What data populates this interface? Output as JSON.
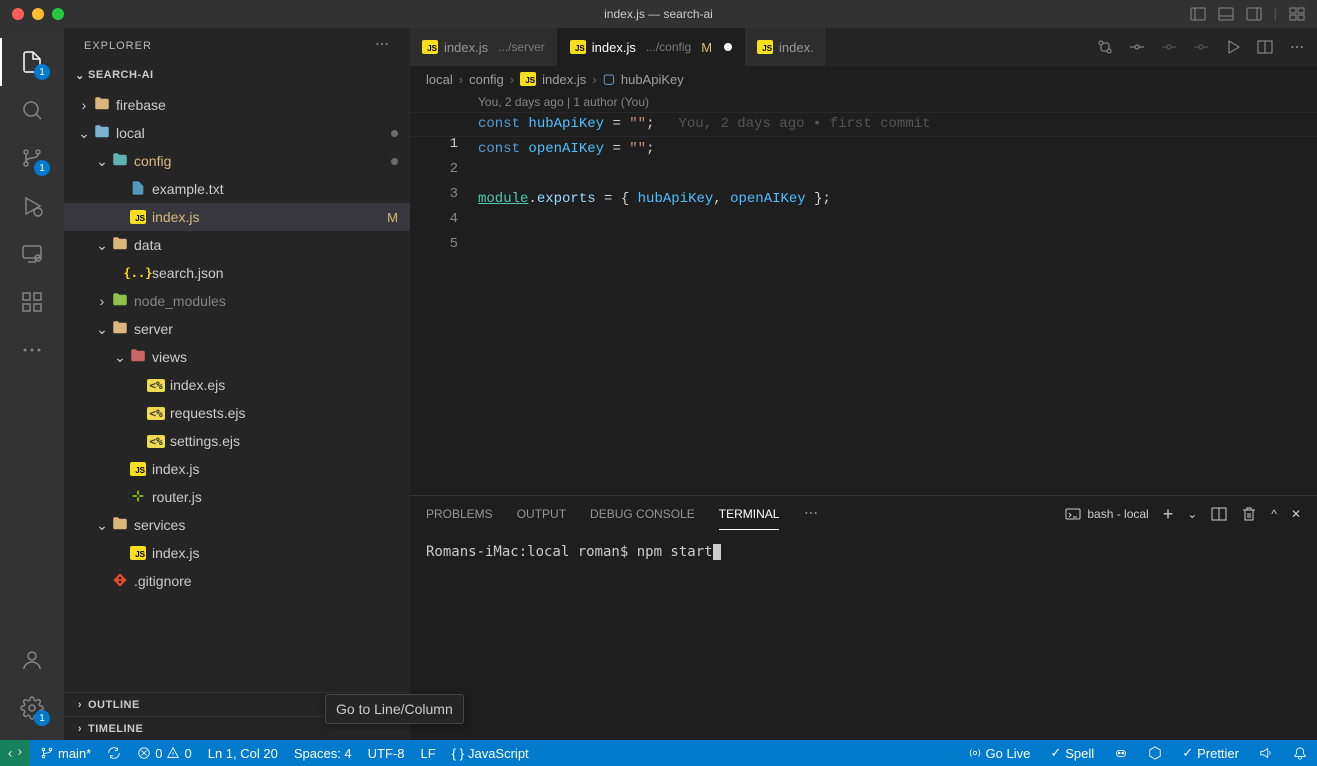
{
  "window": {
    "title": "index.js — search-ai"
  },
  "sidebar": {
    "title": "EXPLORER",
    "project": "SEARCH-AI",
    "outline": "OUTLINE",
    "timeline": "TIMELINE",
    "tree": [
      {
        "indent": 0,
        "chev": ">",
        "icon": "folder",
        "color": "ico-folder",
        "label": "firebase"
      },
      {
        "indent": 0,
        "chev": "v",
        "icon": "folder",
        "color": "ico-folder-blue",
        "label": "local",
        "dot": true
      },
      {
        "indent": 1,
        "chev": "v",
        "icon": "folder",
        "color": "ico-folder-teal",
        "label": "config",
        "dot": true,
        "mod": true
      },
      {
        "indent": 2,
        "chev": "",
        "icon": "file",
        "color": "ico-file-txt",
        "label": "example.txt"
      },
      {
        "indent": 2,
        "chev": "",
        "icon": "js",
        "color": "",
        "label": "index.js",
        "selected": true,
        "status": "M",
        "mod": true
      },
      {
        "indent": 1,
        "chev": "v",
        "icon": "folder",
        "color": "ico-folder",
        "label": "data"
      },
      {
        "indent": 2,
        "chev": "",
        "icon": "json",
        "color": "ico-json",
        "label": "search.json"
      },
      {
        "indent": 1,
        "chev": ">",
        "icon": "folder",
        "color": "ico-folder-green",
        "label": "node_modules",
        "dim": true
      },
      {
        "indent": 1,
        "chev": "v",
        "icon": "folder",
        "color": "ico-folder",
        "label": "server"
      },
      {
        "indent": 2,
        "chev": "v",
        "icon": "folder",
        "color": "ico-folder-red",
        "label": "views"
      },
      {
        "indent": 3,
        "chev": "",
        "icon": "ejs",
        "color": "ico-ejs",
        "label": "index.ejs"
      },
      {
        "indent": 3,
        "chev": "",
        "icon": "ejs",
        "color": "ico-ejs",
        "label": "requests.ejs"
      },
      {
        "indent": 3,
        "chev": "",
        "icon": "ejs",
        "color": "ico-ejs",
        "label": "settings.ejs"
      },
      {
        "indent": 2,
        "chev": "",
        "icon": "js",
        "color": "",
        "label": "index.js"
      },
      {
        "indent": 2,
        "chev": "",
        "icon": "router",
        "color": "ico-router",
        "label": "router.js"
      },
      {
        "indent": 1,
        "chev": "v",
        "icon": "folder",
        "color": "ico-folder",
        "label": "services"
      },
      {
        "indent": 2,
        "chev": "",
        "icon": "js",
        "color": "",
        "label": "index.js"
      },
      {
        "indent": 1,
        "chev": "",
        "icon": "git",
        "color": "ico-git",
        "label": ".gitignore"
      }
    ]
  },
  "tabs": [
    {
      "icon": "js",
      "name": "index.js",
      "path": ".../server"
    },
    {
      "icon": "js",
      "name": "index.js",
      "path": ".../config",
      "status": "M",
      "dirty": true,
      "active": true
    },
    {
      "icon": "js",
      "name": "index.",
      "path": ""
    }
  ],
  "breadcrumb": {
    "p0": "local",
    "p1": "config",
    "p2": "index.js",
    "p3": "hubApiKey"
  },
  "codelens": "You, 2 days ago | 1 author (You)",
  "blame": "You, 2 days ago • first commit",
  "code": {
    "l1a": "const ",
    "l1b": "hubApiKey",
    "l1c": " = ",
    "l1d": "\"\"",
    "l1e": ";",
    "l2a": "const ",
    "l2b": "openAIKey",
    "l2c": " = ",
    "l2d": "\"\"",
    "l2e": ";",
    "l4a": "module",
    "l4b": ".",
    "l4c": "exports",
    "l4d": " = { ",
    "l4e": "hubApiKey",
    "l4f": ", ",
    "l4g": "openAIKey",
    "l4h": " };"
  },
  "linenums": {
    "1": "1",
    "2": "2",
    "3": "3",
    "4": "4",
    "5": "5"
  },
  "panel": {
    "problems": "PROBLEMS",
    "output": "OUTPUT",
    "debug": "DEBUG CONSOLE",
    "terminal": "TERMINAL",
    "shell": "bash - local",
    "prompt": "Romans-iMac:local roman$ npm start"
  },
  "status": {
    "branch": "main*",
    "sync": "",
    "errors": "0",
    "warnings": "0",
    "lncol": "Ln 1, Col 20",
    "spaces": "Spaces: 4",
    "encoding": "UTF-8",
    "eol": "LF",
    "lang": "JavaScript",
    "golive": "Go Live",
    "spell": "Spell",
    "prettier": "Prettier"
  },
  "tooltip": "Go to Line/Column",
  "badges": {
    "explorer": "1",
    "scm": "1",
    "settings": "1"
  }
}
